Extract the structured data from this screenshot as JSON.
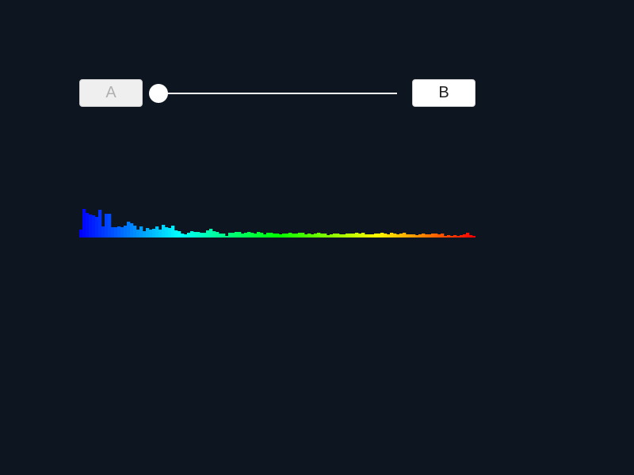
{
  "buttons": {
    "a_label": "A",
    "b_label": "B"
  },
  "slider": {
    "value": 0.0
  },
  "spectrum": {
    "bar_count": 125,
    "values": [
      0.2,
      0.72,
      0.62,
      0.58,
      0.56,
      0.52,
      0.7,
      0.28,
      0.6,
      0.6,
      0.26,
      0.26,
      0.28,
      0.26,
      0.3,
      0.4,
      0.36,
      0.3,
      0.2,
      0.28,
      0.16,
      0.24,
      0.2,
      0.22,
      0.28,
      0.2,
      0.32,
      0.26,
      0.24,
      0.3,
      0.18,
      0.16,
      0.1,
      0.08,
      0.12,
      0.16,
      0.14,
      0.14,
      0.12,
      0.12,
      0.18,
      0.22,
      0.16,
      0.14,
      0.1,
      0.1,
      0.04,
      0.12,
      0.12,
      0.14,
      0.14,
      0.1,
      0.12,
      0.14,
      0.12,
      0.1,
      0.14,
      0.12,
      0.08,
      0.12,
      0.12,
      0.1,
      0.1,
      0.08,
      0.1,
      0.1,
      0.12,
      0.1,
      0.1,
      0.12,
      0.12,
      0.08,
      0.1,
      0.08,
      0.1,
      0.12,
      0.1,
      0.1,
      0.06,
      0.08,
      0.1,
      0.1,
      0.08,
      0.08,
      0.1,
      0.1,
      0.1,
      0.12,
      0.1,
      0.12,
      0.08,
      0.08,
      0.08,
      0.1,
      0.1,
      0.12,
      0.1,
      0.08,
      0.12,
      0.1,
      0.08,
      0.1,
      0.12,
      0.08,
      0.08,
      0.08,
      0.06,
      0.08,
      0.1,
      0.08,
      0.08,
      0.1,
      0.1,
      0.08,
      0.1,
      0.04,
      0.06,
      0.04,
      0.06,
      0.04,
      0.06,
      0.08,
      0.12,
      0.06,
      0.04
    ],
    "colors": [
      "#0000ff",
      "#00ffff",
      "#00ff00",
      "#ffff00",
      "#ff0000"
    ]
  }
}
